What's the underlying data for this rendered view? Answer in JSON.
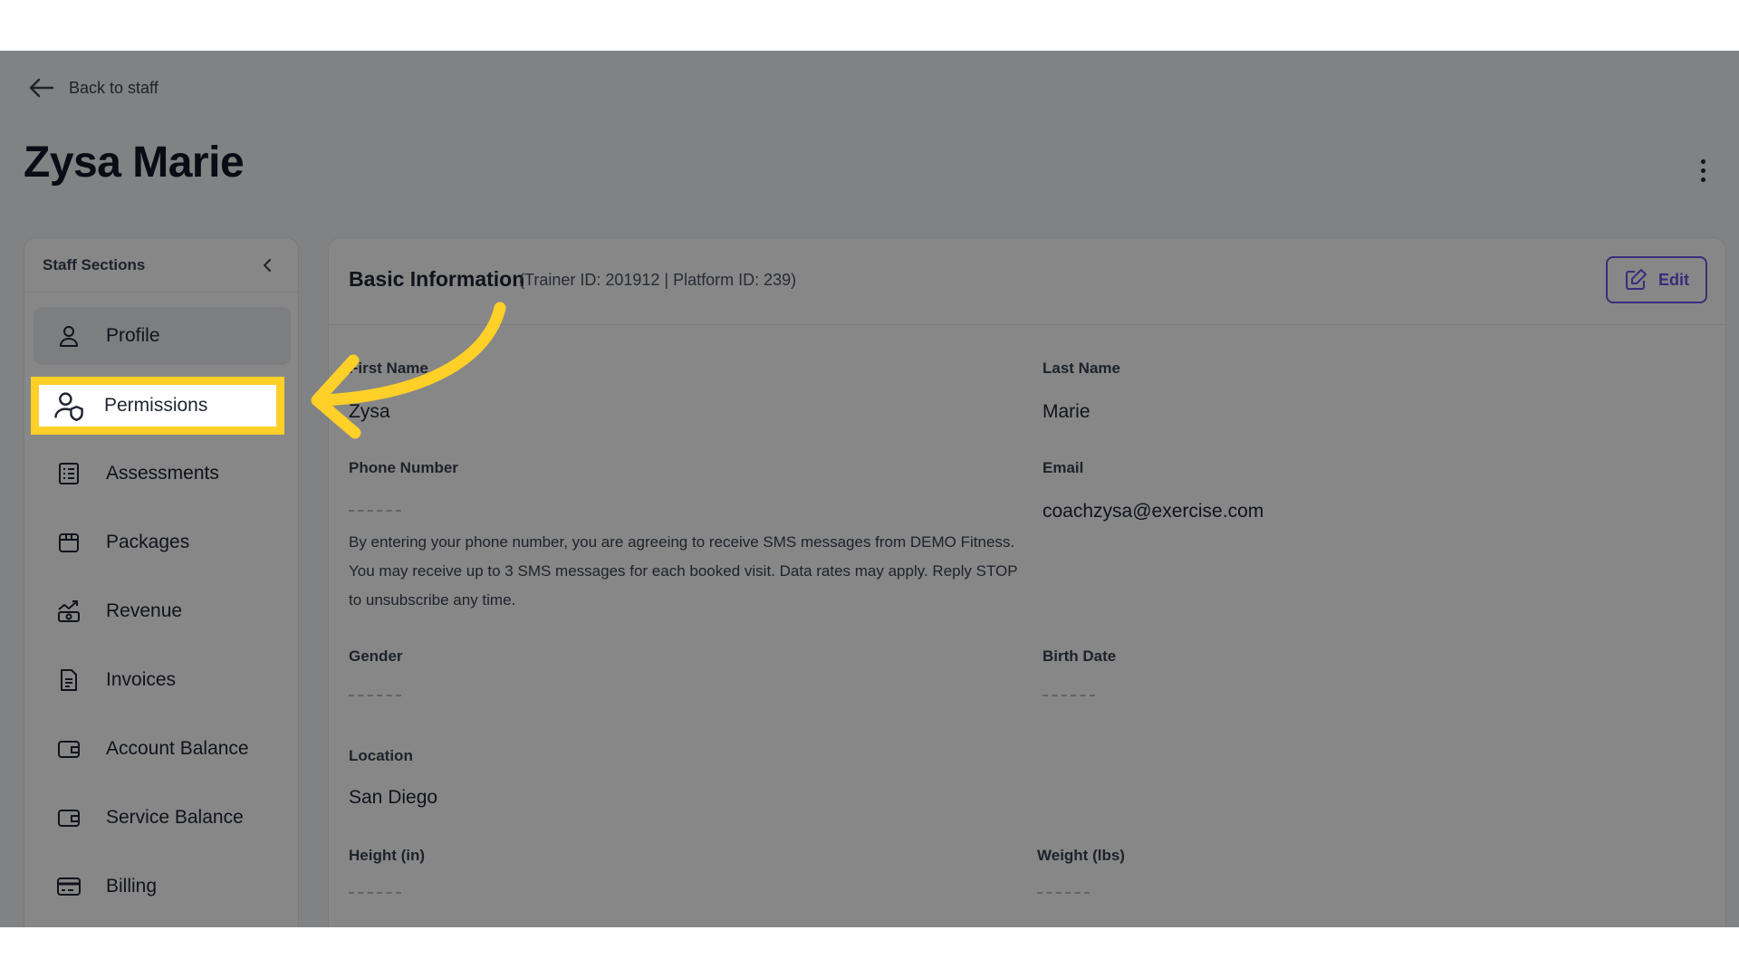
{
  "nav": {
    "back_label": "Back to staff"
  },
  "page": {
    "title": "Zysa Marie"
  },
  "sidebar": {
    "title": "Staff Sections",
    "items": [
      {
        "label": "Profile",
        "icon": "user-icon",
        "active": true
      },
      {
        "label": "Permissions",
        "icon": "user-shield-icon",
        "highlighted": true
      },
      {
        "label": "Assessments",
        "icon": "checklist-icon"
      },
      {
        "label": "Packages",
        "icon": "package-icon"
      },
      {
        "label": "Revenue",
        "icon": "revenue-icon"
      },
      {
        "label": "Invoices",
        "icon": "invoice-icon"
      },
      {
        "label": "Account Balance",
        "icon": "wallet-icon"
      },
      {
        "label": "Service Balance",
        "icon": "wallet-icon"
      },
      {
        "label": "Billing",
        "icon": "credit-card-icon"
      }
    ]
  },
  "card": {
    "title": "Basic Information",
    "subtitle": "(Trainer ID: 201912 | Platform ID: 239)",
    "edit_label": "Edit",
    "fields": {
      "first_name": {
        "label": "First Name",
        "value": "Zysa"
      },
      "last_name": {
        "label": "Last Name",
        "value": "Marie"
      },
      "phone": {
        "label": "Phone Number",
        "value": "",
        "note": "By entering your phone number, you are agreeing to receive SMS messages from DEMO Fitness. You may receive up to 3 SMS messages for each booked visit. Data rates may apply. Reply STOP to unsubscribe any time."
      },
      "email": {
        "label": "Email",
        "value": "coachzysa@exercise.com"
      },
      "gender": {
        "label": "Gender",
        "value": ""
      },
      "birth_date": {
        "label": "Birth Date",
        "value": ""
      },
      "location": {
        "label": "Location",
        "value": "San Diego"
      },
      "height": {
        "label": "Height (in)",
        "value": ""
      },
      "weight": {
        "label": "Weight (lbs)",
        "value": ""
      }
    }
  },
  "colors": {
    "accent": "#6d56e8",
    "highlight": "#ffd028",
    "overlay": "rgba(0,0,0,0.47)"
  }
}
